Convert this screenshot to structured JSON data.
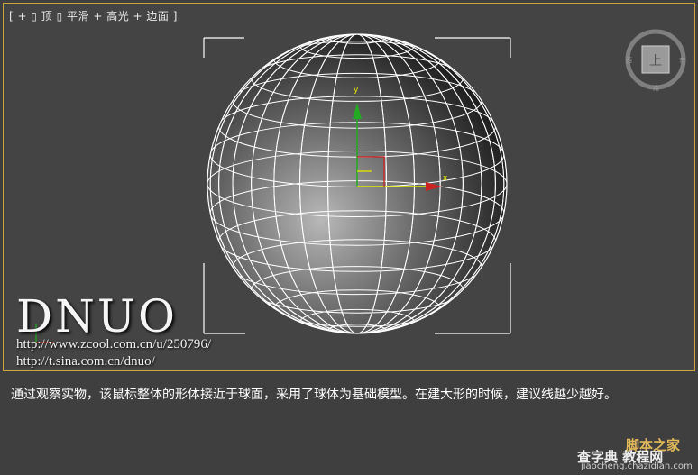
{
  "viewport": {
    "label": "[ + ▯ 顶 ▯ 平滑 + 高光 + 边面 ]",
    "axis_x": "x",
    "axis_y": "y",
    "viewcube_face": "上",
    "viewcube_west": "西",
    "viewcube_east": "东",
    "viewcube_south": "南"
  },
  "watermark": {
    "brand": "DNUO",
    "url1": "http://www.zcool.com.cn/u/250796/",
    "url2": "http://t.sina.com.cn/dnuo/"
  },
  "caption": "通过观察实物，该鼠标整体的形体接近于球面，采用了球体为基础模型。在建大形的时候，建议线越少越好。",
  "site_watermark": {
    "cn_top": "脚本之家",
    "cn_bottom": "查字典 教程网",
    "url": "jiaocheng.chazidian.com"
  },
  "colors": {
    "frame": "#cfa23c",
    "viewport_bg": "#444444",
    "page_bg": "#3f3f3f",
    "wire": "#ffffff",
    "gizmo_y": "#22aa22",
    "gizmo_x": "#cc2222",
    "gizmo_axis_yellow": "#e6e600"
  }
}
